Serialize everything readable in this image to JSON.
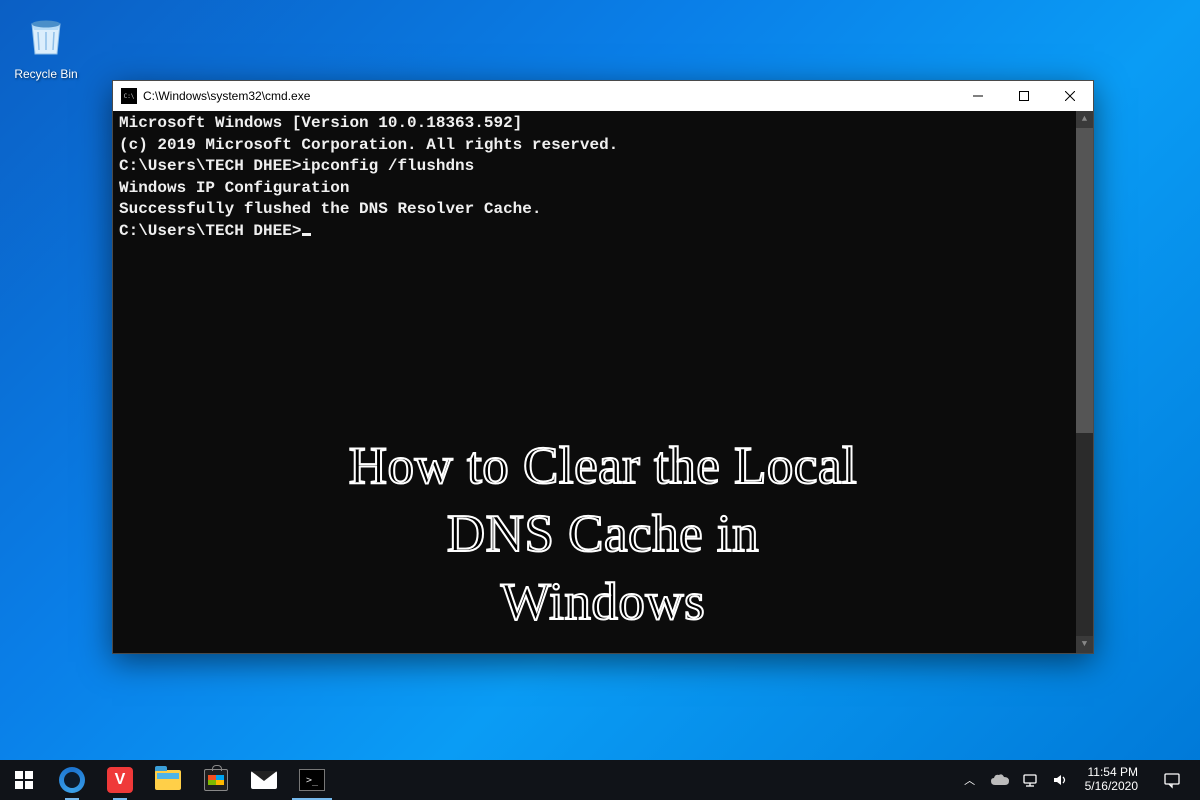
{
  "desktop": {
    "recycle_bin_label": "Recycle Bin"
  },
  "cmd": {
    "title": "C:\\Windows\\system32\\cmd.exe",
    "lines": {
      "l1": "Microsoft Windows [Version 10.0.18363.592]",
      "l2": "(c) 2019 Microsoft Corporation. All rights reserved.",
      "blank1": "",
      "l3": "C:\\Users\\TECH DHEE>ipconfig /flushdns",
      "blank2": "",
      "l4": "Windows IP Configuration",
      "blank3": "",
      "l5": "Successfully flushed the DNS Resolver Cache.",
      "blank4": "",
      "l6": "C:\\Users\\TECH DHEE>"
    }
  },
  "overlay": {
    "line1": "How to Clear the Local",
    "line2": "DNS Cache in",
    "line3": "Windows"
  },
  "taskbar": {
    "time": "11:54 PM",
    "date": "5/16/2020"
  }
}
